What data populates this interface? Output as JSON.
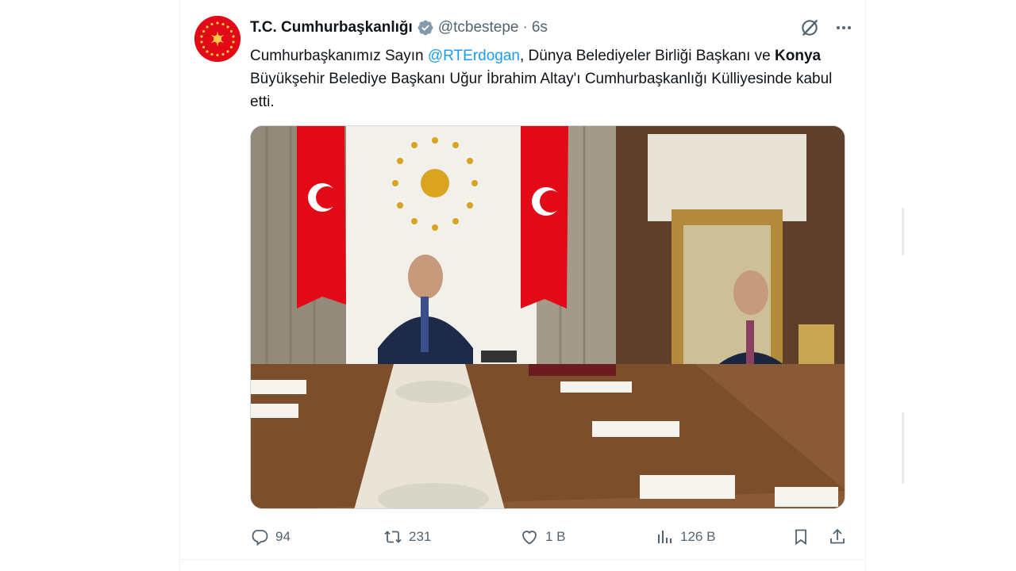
{
  "tweet": {
    "author": {
      "display_name": "T.C. Cumhurbaşkanlığı",
      "handle": "@tcbestepe",
      "separator": "·",
      "time": "6s",
      "verified_color": "#829aab",
      "avatar_color": "#e30a17"
    },
    "text": {
      "part1": "Cumhurbaşkanımız Sayın ",
      "mention": "@RTErdogan",
      "part2": ", Dünya Belediyeler Birliği Başkanı ve ",
      "bold_word": "Konya",
      "part3": " Büyükşehir Belediye Başkanı Uğur İbrahim Altay'ı Cumhurbaşkanlığı Külliyesinde kabul etti."
    },
    "media": {
      "alt": "",
      "colors": {
        "flag": "#e30a17",
        "wood": "#8a5a36",
        "curtain": "#9c9486",
        "table_runner": "#e9e4d6"
      }
    },
    "metrics": {
      "replies": "94",
      "retweets": "231",
      "likes": "1 B",
      "views": "126 B"
    },
    "icons": {
      "grok": "grok-icon",
      "more": "more-icon",
      "reply": "reply-icon",
      "retweet": "retweet-icon",
      "like": "like-icon",
      "views": "views-icon",
      "bookmark": "bookmark-icon",
      "share": "share-icon"
    },
    "accent_color": "#1d9bf0",
    "muted_color": "#536471"
  }
}
